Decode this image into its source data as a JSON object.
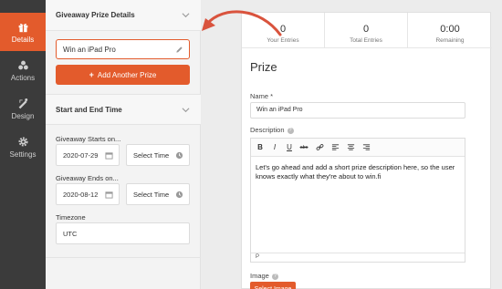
{
  "sidebar": {
    "items": [
      {
        "label": "Details",
        "icon": "gift-icon",
        "active": true
      },
      {
        "label": "Actions",
        "icon": "actions-icon",
        "active": false
      },
      {
        "label": "Design",
        "icon": "design-tools-icon",
        "active": false
      },
      {
        "label": "Settings",
        "icon": "gear-icon",
        "active": false
      }
    ]
  },
  "panel": {
    "prize_section": {
      "title": "Giveaway Prize Details",
      "prize_name_value": "Win an iPad Pro",
      "add_button_label": "Add Another Prize"
    },
    "time_section": {
      "title": "Start and End Time",
      "starts_label": "Giveaway Starts on...",
      "start_date": "2020-07-29",
      "start_time_placeholder": "Select Time",
      "ends_label": "Giveaway Ends on...",
      "end_date": "2020-08-12",
      "end_time_placeholder": "Select Time",
      "timezone_label": "Timezone",
      "timezone_value": "UTC"
    }
  },
  "preview": {
    "stats": [
      {
        "number": "0",
        "label": "Your Entries"
      },
      {
        "number": "0",
        "label": "Total Entries"
      },
      {
        "number": "0:00",
        "label": "Remaining"
      }
    ],
    "heading": "Prize",
    "name_label": "Name *",
    "name_value": "Win an iPad Pro",
    "description_label": "Description",
    "toolbar": [
      "B",
      "I",
      "U",
      "abc"
    ],
    "description_text": "Let's go ahead and add a short prize description here, so the user knows exactly what they're about to win.fi",
    "editor_footer": "P",
    "image_label": "Image",
    "select_image_label": "Select Image"
  },
  "colors": {
    "accent": "#e35b2c",
    "rail": "#3b3b3b",
    "panel": "#f3f3f3"
  }
}
